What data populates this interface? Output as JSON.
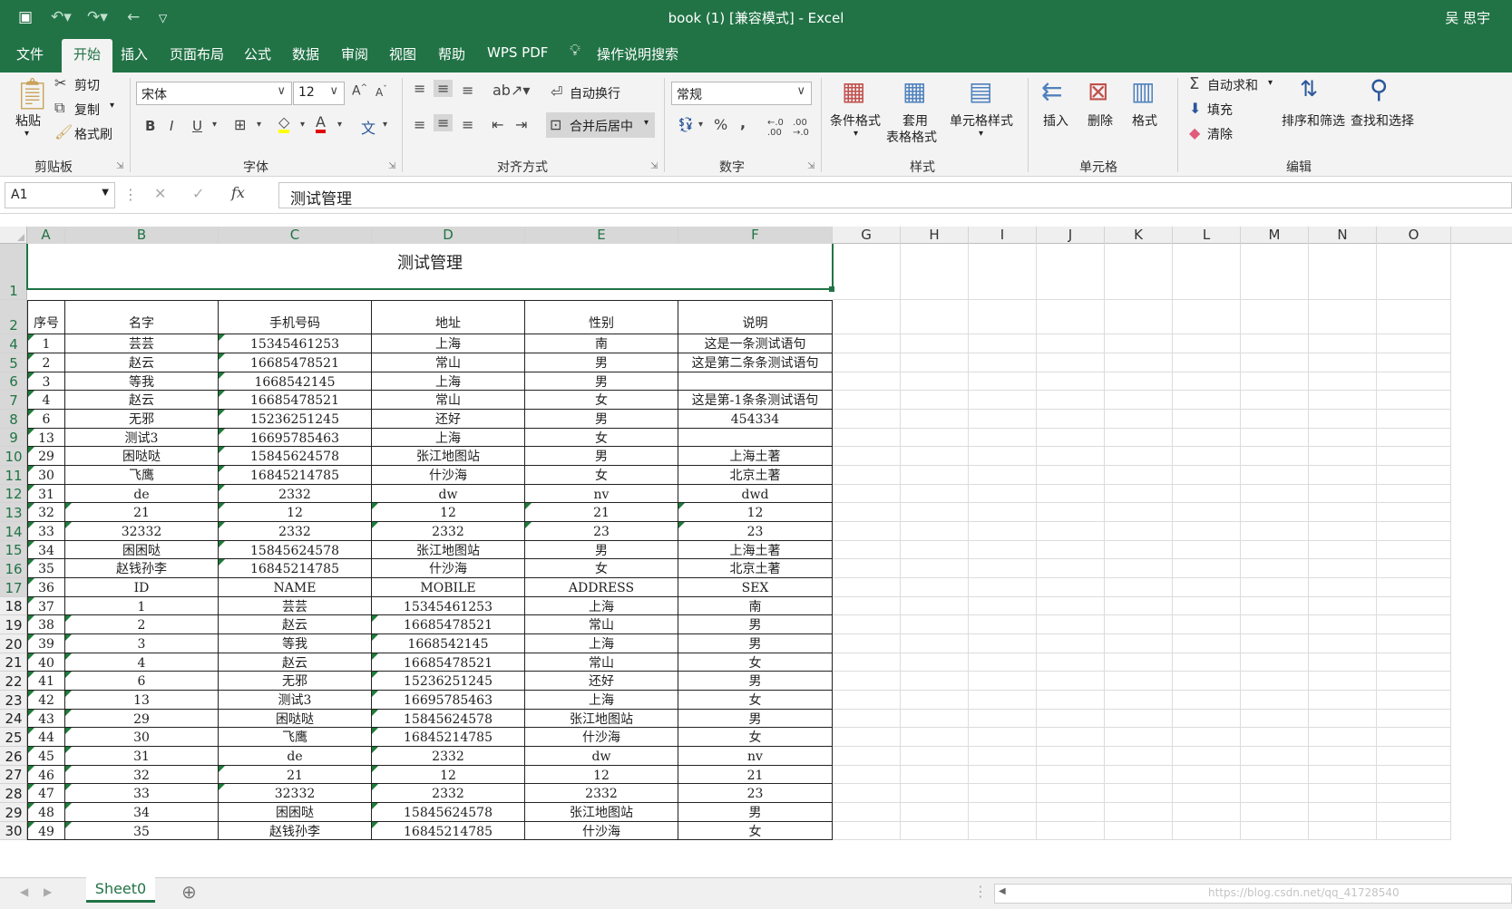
{
  "window": {
    "title": "book (1)  [兼容模式]  -  Excel",
    "user": "吴 思宇"
  },
  "qat": [
    "save-icon",
    "undo-icon",
    "redo-icon",
    "back-icon",
    "customize-icon"
  ],
  "tabs": [
    "文件",
    "开始",
    "插入",
    "页面布局",
    "公式",
    "数据",
    "审阅",
    "视图",
    "帮助",
    "WPS PDF",
    "操作说明搜索"
  ],
  "active_tab": "开始",
  "ribbon": {
    "clipboard": {
      "paste": "粘贴",
      "cut": "剪切",
      "copy": "复制",
      "format_painter": "格式刷",
      "label": "剪贴板"
    },
    "font": {
      "name": "宋体",
      "size": "12",
      "label": "字体",
      "bold": "B",
      "italic": "I",
      "underline": "U"
    },
    "alignment": {
      "wrap": "自动换行",
      "merge": "合并后居中",
      "label": "对齐方式"
    },
    "number": {
      "format": "常规",
      "label": "数字"
    },
    "styles": {
      "cond": "条件格式",
      "table1": "套用",
      "table2": "表格格式",
      "cell": "单元格样式",
      "label": "样式"
    },
    "cells": {
      "insert": "插入",
      "delete": "删除",
      "format": "格式",
      "label": "单元格"
    },
    "editing": {
      "autosum": "自动求和",
      "fill": "填充",
      "clear": "清除",
      "sort": "排序和筛选",
      "find": "查找和选择",
      "label": "编辑"
    }
  },
  "formula_bar": {
    "name_box": "A1",
    "content": "测试管理"
  },
  "columns": [
    "A",
    "B",
    "C",
    "D",
    "E",
    "F",
    "G",
    "H",
    "I",
    "J",
    "K",
    "L",
    "M",
    "N",
    "O"
  ],
  "rows": [
    {
      "num": "1",
      "cells": []
    },
    {
      "num": "2",
      "cells": [
        "序号",
        "名字",
        "手机号码",
        "地址",
        "性别",
        "说明"
      ]
    },
    {
      "num": "4",
      "cells": [
        "1",
        "芸芸",
        "15345461253",
        "上海",
        "南",
        "这是一条测试语句"
      ]
    },
    {
      "num": "5",
      "cells": [
        "2",
        "赵云",
        "16685478521",
        "常山",
        "男",
        "这是第二条条测试语句"
      ]
    },
    {
      "num": "6",
      "cells": [
        "3",
        "等我",
        "1668542145",
        "上海",
        "男",
        ""
      ]
    },
    {
      "num": "7",
      "cells": [
        "4",
        "赵云",
        "16685478521",
        "常山",
        "女",
        "这是第-1条条测试语句"
      ]
    },
    {
      "num": "8",
      "cells": [
        "6",
        "无邪",
        "15236251245",
        "还好",
        "男",
        "454334"
      ]
    },
    {
      "num": "9",
      "cells": [
        "13",
        "测试3",
        "16695785463",
        "上海",
        "女",
        ""
      ]
    },
    {
      "num": "10",
      "cells": [
        "29",
        "困哒哒",
        "15845624578",
        "张江地图站",
        "男",
        "上海土著"
      ]
    },
    {
      "num": "11",
      "cells": [
        "30",
        "飞鹰",
        "16845214785",
        "什沙海",
        "女",
        "北京土著"
      ]
    },
    {
      "num": "12",
      "cells": [
        "31",
        "de",
        "2332",
        "dw",
        "nv",
        "dwd"
      ]
    },
    {
      "num": "13",
      "cells": [
        "32",
        "21",
        "12",
        "12",
        "21",
        "12"
      ]
    },
    {
      "num": "14",
      "cells": [
        "33",
        "32332",
        "2332",
        "2332",
        "23",
        "23"
      ]
    },
    {
      "num": "15",
      "cells": [
        "34",
        "困困哒",
        "15845624578",
        "张江地图站",
        "男",
        "上海土著"
      ]
    },
    {
      "num": "16",
      "cells": [
        "35",
        "赵钱孙李",
        "16845214785",
        "什沙海",
        "女",
        "北京土著"
      ]
    },
    {
      "num": "17",
      "cells": [
        "36",
        "ID",
        "NAME",
        "MOBILE",
        "ADDRESS",
        "SEX"
      ]
    },
    {
      "num": "18",
      "cells": [
        "37",
        "1",
        "芸芸",
        "15345461253",
        "上海",
        "南"
      ]
    },
    {
      "num": "19",
      "cells": [
        "38",
        "2",
        "赵云",
        "16685478521",
        "常山",
        "男"
      ]
    },
    {
      "num": "20",
      "cells": [
        "39",
        "3",
        "等我",
        "1668542145",
        "上海",
        "男"
      ]
    },
    {
      "num": "21",
      "cells": [
        "40",
        "4",
        "赵云",
        "16685478521",
        "常山",
        "女"
      ]
    },
    {
      "num": "22",
      "cells": [
        "41",
        "6",
        "无邪",
        "15236251245",
        "还好",
        "男"
      ]
    },
    {
      "num": "23",
      "cells": [
        "42",
        "13",
        "测试3",
        "16695785463",
        "上海",
        "女"
      ]
    },
    {
      "num": "24",
      "cells": [
        "43",
        "29",
        "困哒哒",
        "15845624578",
        "张江地图站",
        "男"
      ]
    },
    {
      "num": "25",
      "cells": [
        "44",
        "30",
        "飞鹰",
        "16845214785",
        "什沙海",
        "女"
      ]
    },
    {
      "num": "26",
      "cells": [
        "45",
        "31",
        "de",
        "2332",
        "dw",
        "nv"
      ]
    },
    {
      "num": "27",
      "cells": [
        "46",
        "32",
        "21",
        "12",
        "12",
        "21"
      ]
    },
    {
      "num": "28",
      "cells": [
        "47",
        "33",
        "32332",
        "2332",
        "2332",
        "23"
      ]
    },
    {
      "num": "29",
      "cells": [
        "48",
        "34",
        "困困哒",
        "15845624578",
        "张江地图站",
        "男"
      ]
    },
    {
      "num": "30",
      "cells": [
        "49",
        "35",
        "赵钱孙李",
        "16845214785",
        "什沙海",
        "女"
      ]
    }
  ],
  "merged_title": "测试管理",
  "sheet_tabs": [
    "Sheet0"
  ],
  "watermark": "https://blog.csdn.net/qq_41728540",
  "colors": {
    "accent": "#217346",
    "error_triangle": "#1e7b3a"
  }
}
